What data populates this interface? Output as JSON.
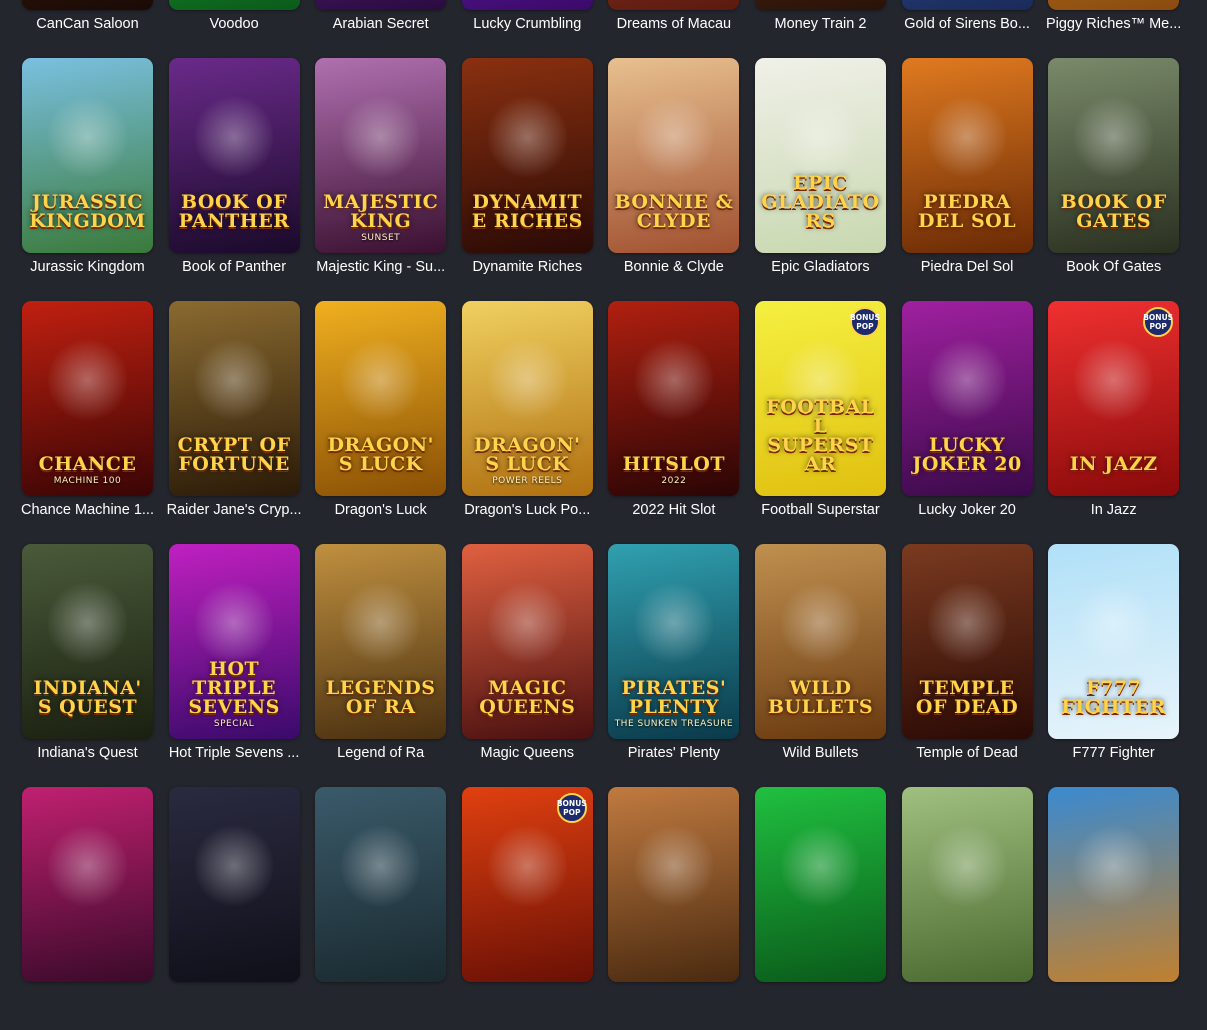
{
  "badge_text": "BONUS POP",
  "games": [
    {
      "name": "CanCan Saloon",
      "art": "",
      "bg": [
        "#5a2a10",
        "#1a0a05"
      ]
    },
    {
      "name": "Voodoo",
      "art": "",
      "bg": [
        "#2ecc40",
        "#0a5a1a"
      ]
    },
    {
      "name": "Arabian Secret",
      "art": "",
      "bg": [
        "#7a3aa0",
        "#2a0a40"
      ]
    },
    {
      "name": "Lucky Crumbling",
      "art": "",
      "bg": [
        "#8a2ad0",
        "#3a0a6a"
      ]
    },
    {
      "name": "Dreams of Macau",
      "art": "",
      "bg": [
        "#c0502a",
        "#5a1a10"
      ]
    },
    {
      "name": "Money Train 2",
      "art": "",
      "bg": [
        "#6a3a20",
        "#2a1208"
      ]
    },
    {
      "name": "Gold of Sirens Bo...",
      "art": "",
      "bg": [
        "#3a6ab0",
        "#1a2a5a"
      ]
    },
    {
      "name": "Piggy Riches™ Me...",
      "art": "",
      "bg": [
        "#e0a020",
        "#8a4a10"
      ]
    },
    {
      "name": "Jurassic Kingdom",
      "art": "Jurassic Kingdom",
      "bg": [
        "#7ac0e0",
        "#3a7a3a"
      ]
    },
    {
      "name": "Book of Panther",
      "art": "Book of Panther",
      "bg": [
        "#6a2a8a",
        "#1a0a2a"
      ]
    },
    {
      "name": "Majestic King - Su...",
      "art": "Majestic King",
      "sub": "Sunset",
      "bg": [
        "#b070b0",
        "#3a1030"
      ]
    },
    {
      "name": "Dynamite Riches",
      "art": "Dynamite Riches",
      "bg": [
        "#8a3010",
        "#2a0a05"
      ]
    },
    {
      "name": "Bonnie & Clyde",
      "art": "Bonnie & Clyde",
      "bg": [
        "#e8c090",
        "#a05030"
      ]
    },
    {
      "name": "Epic Gladiators",
      "art": "Epic Gladiators",
      "bg": [
        "#f0f0e8",
        "#c8d8b0"
      ]
    },
    {
      "name": "Piedra Del Sol",
      "art": "Piedra Del Sol",
      "bg": [
        "#e07a20",
        "#6a2a05"
      ]
    },
    {
      "name": "Book Of Gates",
      "art": "Book of Gates",
      "bg": [
        "#7a8a6a",
        "#2a3020"
      ]
    },
    {
      "name": "Chance Machine 1...",
      "art": "Chance",
      "sub": "machine 100",
      "bg": [
        "#c02010",
        "#3a0505"
      ]
    },
    {
      "name": "Raider Jane's Cryp...",
      "art": "Crypt of Fortune",
      "bg": [
        "#8a6a30",
        "#2a1a08"
      ]
    },
    {
      "name": "Dragon's Luck",
      "art": "Dragon's Luck",
      "bg": [
        "#f0b020",
        "#8a5005"
      ]
    },
    {
      "name": "Dragon's Luck Po...",
      "art": "Dragon's Luck",
      "sub": "Power Reels",
      "bg": [
        "#f0d060",
        "#b07010"
      ]
    },
    {
      "name": "2022 Hit Slot",
      "art": "Hitslot",
      "sub": "2022",
      "bg": [
        "#b02010",
        "#2a0505"
      ]
    },
    {
      "name": "Football Superstar",
      "art": "Football Superstar",
      "bg": [
        "#f5f040",
        "#e0c010"
      ],
      "badge": true
    },
    {
      "name": "Lucky Joker 20",
      "art": "Lucky Joker 20",
      "bg": [
        "#a020a0",
        "#3a0a4a"
      ]
    },
    {
      "name": "In Jazz",
      "art": "In Jazz",
      "bg": [
        "#f03030",
        "#8a0a0a"
      ],
      "badge": true
    },
    {
      "name": "Indiana's Quest",
      "art": "Indiana's Quest",
      "bg": [
        "#4a5a3a",
        "#1a2010"
      ]
    },
    {
      "name": "Hot Triple Sevens ...",
      "art": "Hot Triple Sevens",
      "sub": "Special",
      "bg": [
        "#c020c0",
        "#3a0a6a"
      ]
    },
    {
      "name": "Legend of Ra",
      "art": "Legends of Ra",
      "bg": [
        "#c09040",
        "#4a3010"
      ]
    },
    {
      "name": "Magic Queens",
      "art": "Magic Queens",
      "bg": [
        "#e06040",
        "#4a1010"
      ]
    },
    {
      "name": "Pirates' Plenty",
      "art": "Pirates' Plenty",
      "sub": "The Sunken Treasure",
      "bg": [
        "#30a0b0",
        "#0a3a4a"
      ]
    },
    {
      "name": "Wild Bullets",
      "art": "Wild Bullets",
      "bg": [
        "#c09050",
        "#6a3a10"
      ]
    },
    {
      "name": "Temple of Dead",
      "art": "Temple of Dead",
      "bg": [
        "#7a3a20",
        "#2a0a05"
      ]
    },
    {
      "name": "F777 Fighter",
      "art": "F777 Fighter",
      "bg": [
        "#b0e0f8",
        "#e8f4fa"
      ]
    },
    {
      "name": "",
      "art": "",
      "bg": [
        "#c02070",
        "#3a0a2a"
      ]
    },
    {
      "name": "",
      "art": "",
      "bg": [
        "#2a2a40",
        "#10101a"
      ]
    },
    {
      "name": "",
      "art": "",
      "bg": [
        "#3a5a6a",
        "#1a2a30"
      ]
    },
    {
      "name": "",
      "art": "",
      "bg": [
        "#e04010",
        "#6a1005"
      ],
      "badge": true
    },
    {
      "name": "",
      "art": "",
      "bg": [
        "#c07a40",
        "#4a2a10"
      ]
    },
    {
      "name": "",
      "art": "",
      "bg": [
        "#20c040",
        "#0a5a1a"
      ]
    },
    {
      "name": "",
      "art": "",
      "bg": [
        "#a0c080",
        "#4a6a30"
      ]
    },
    {
      "name": "",
      "art": "",
      "bg": [
        "#3a8ad0",
        "#c08030"
      ]
    }
  ]
}
